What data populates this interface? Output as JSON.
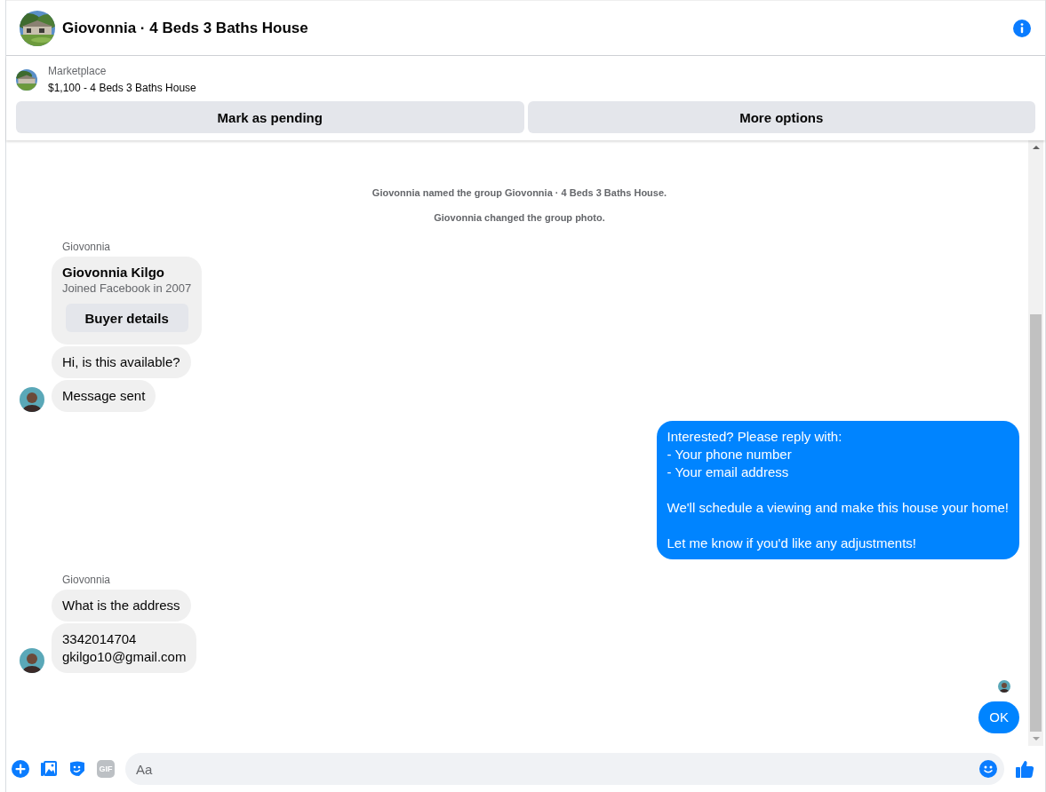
{
  "header": {
    "title": "Giovonnia · 4 Beds 3 Baths House"
  },
  "listing": {
    "source": "Marketplace",
    "summary": "$1,100 - 4 Beds 3 Baths House",
    "actions": [
      "Mark as pending",
      "More options"
    ]
  },
  "messages": [
    {
      "kind": "system",
      "text": "Giovonnia named the group Giovonnia · 4 Beds 3 Baths House."
    },
    {
      "kind": "system",
      "text": "Giovonnia changed the group photo."
    },
    {
      "kind": "incoming",
      "sender": "Giovonnia",
      "items": [
        {
          "kind": "card",
          "title": "Giovonnia Kilgo",
          "subtitle": "Joined Facebook in 2007",
          "button": "Buyer details"
        },
        {
          "kind": "text",
          "lines": [
            "Hi, is this available?"
          ]
        },
        {
          "kind": "text",
          "lines": [
            "Message sent"
          ]
        }
      ]
    },
    {
      "kind": "outgoing",
      "paragraphs": [
        [
          "Interested? Please reply with:",
          "- Your phone number",
          "- Your email address"
        ],
        [
          "We'll schedule a viewing and make this house your home!"
        ],
        [
          "Let me know if you'd like any adjustments!"
        ]
      ]
    },
    {
      "kind": "incoming",
      "sender": "Giovonnia",
      "items": [
        {
          "kind": "text",
          "lines": [
            "What is the address"
          ]
        },
        {
          "kind": "text",
          "lines": [
            "3342014704",
            "gkilgo10@gmail.com"
          ]
        }
      ]
    },
    {
      "kind": "seen"
    },
    {
      "kind": "outgoing",
      "paragraphs": [
        [
          "OK"
        ]
      ]
    }
  ],
  "composer": {
    "gif_label": "GIF",
    "placeholder": "Aa"
  }
}
